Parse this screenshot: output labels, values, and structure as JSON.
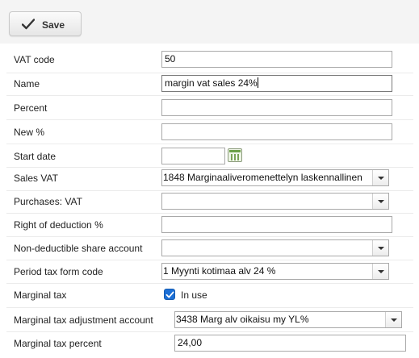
{
  "toolbar": {
    "save_label": "Save",
    "save_icon": "checkmark-icon"
  },
  "form": {
    "vat_code": {
      "label": "VAT code",
      "value": "50"
    },
    "name": {
      "label": "Name",
      "value": "margin vat sales 24%"
    },
    "percent": {
      "label": "Percent",
      "value": ""
    },
    "new_percent": {
      "label": "New %",
      "value": ""
    },
    "start_date": {
      "label": "Start date",
      "value": "",
      "icon": "calendar-icon"
    },
    "sales_vat": {
      "label": "Sales VAT",
      "value": "1848 Marginaaliveromenettelyn laskennallinen"
    },
    "purchases_vat": {
      "label": "Purchases: VAT",
      "value": ""
    },
    "right_of_deduction": {
      "label": "Right of deduction %",
      "value": ""
    },
    "non_deductible_share": {
      "label": "Non-deductible share account",
      "value": ""
    },
    "period_tax_form_code": {
      "label": "Period tax form code",
      "value": "1 Myynti kotimaa alv 24 %"
    },
    "marginal_tax": {
      "label": "Marginal tax",
      "checkbox_label": "In use",
      "checked": true
    },
    "marginal_tax_adjustment_account": {
      "label": "Marginal tax adjustment account",
      "value": "3438 Marg alv oikaisu my YL%"
    },
    "marginal_tax_percent": {
      "label": "Marginal tax percent",
      "value": "24,00"
    }
  }
}
